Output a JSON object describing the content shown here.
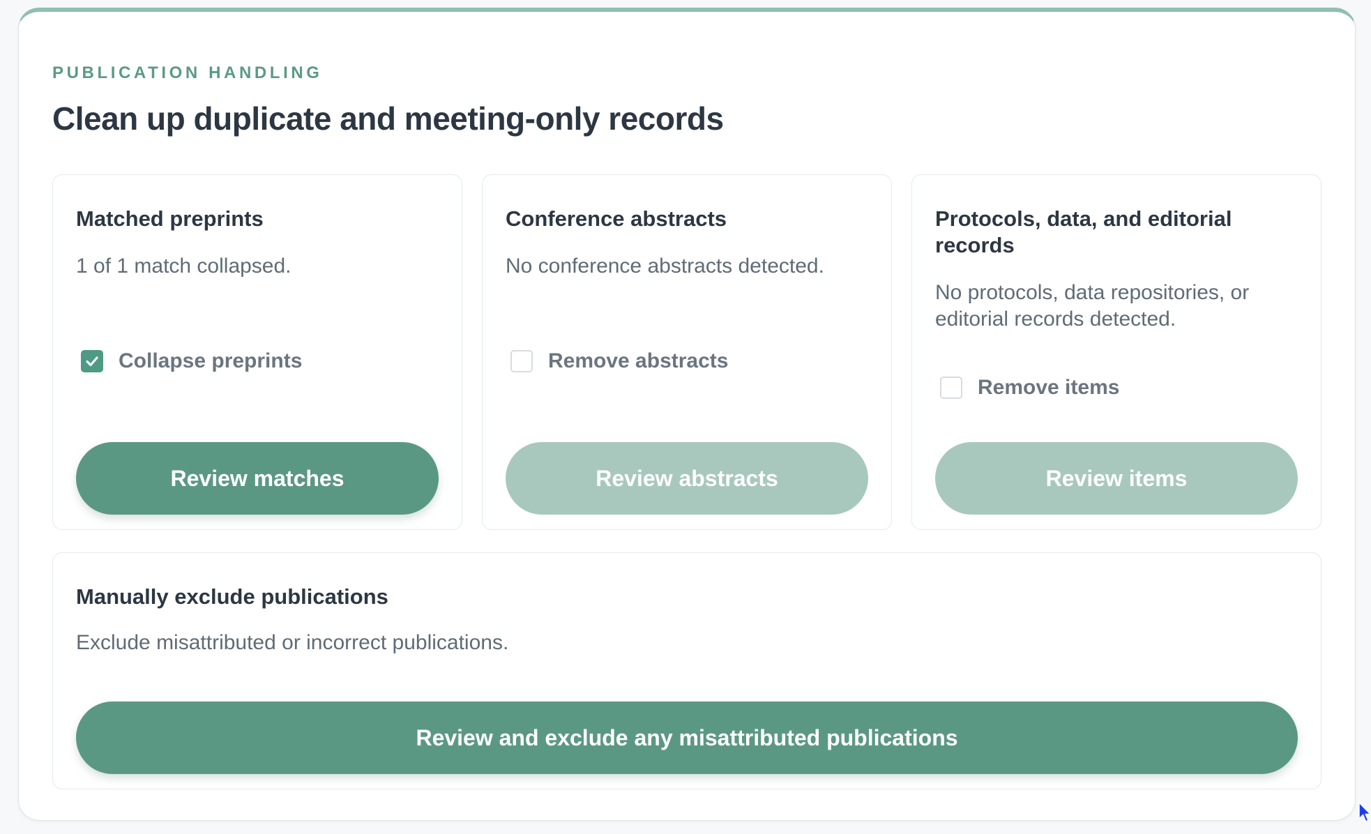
{
  "section": {
    "eyebrow": "PUBLICATION HANDLING",
    "title": "Clean up duplicate and meeting-only records"
  },
  "cards": [
    {
      "title": "Matched preprints",
      "description": "1 of 1 match collapsed.",
      "checkbox_label": "Collapse preprints",
      "checked": true,
      "button_label": "Review matches",
      "button_enabled": true
    },
    {
      "title": "Conference abstracts",
      "description": "No conference abstracts detected.",
      "checkbox_label": "Remove abstracts",
      "checked": false,
      "button_label": "Review abstracts",
      "button_enabled": false
    },
    {
      "title": "Protocols, data, and editorial records",
      "description": "No protocols, data repositories, or editorial records detected.",
      "checkbox_label": "Remove items",
      "checked": false,
      "button_label": "Review items",
      "button_enabled": false
    }
  ],
  "manual_exclude": {
    "title": "Manually exclude publications",
    "description": "Exclude misattributed or incorrect publications.",
    "button_label": "Review and exclude any misattributed publications"
  },
  "colors": {
    "accent": "#5b9884",
    "accent_disabled": "#a8c8be",
    "eyebrow": "#5a9a83",
    "top_border": "#8fbfae"
  },
  "icons": {
    "checkmark": "check-icon",
    "cursor": "mouse-pointer-icon"
  }
}
